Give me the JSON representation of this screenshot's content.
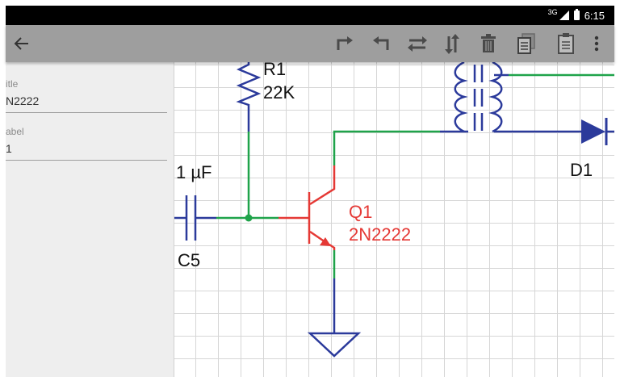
{
  "status_bar": {
    "network": "3G",
    "time": "6:15"
  },
  "toolbar": {
    "back_icon": "arrow-left-icon",
    "actions": [
      "rotate-right-icon",
      "rotate-left-icon",
      "flip-horizontal-icon",
      "flip-vertical-icon",
      "delete-icon",
      "copy-icon",
      "paste-icon",
      "overflow-menu-icon"
    ]
  },
  "properties": {
    "title_label": "itle",
    "title_value": "N2222",
    "label_label": "abel",
    "label_value": "1"
  },
  "schematic": {
    "resistor": {
      "name": "R1",
      "value": "22K"
    },
    "capacitor": {
      "value": "1 µF",
      "name": "C5"
    },
    "transistor": {
      "name": "Q1",
      "part": "2N2222"
    },
    "diode": {
      "name": "D1"
    },
    "colors": {
      "wire": "#1fa34a",
      "component": "#2b3a9b",
      "selected": "#e53935",
      "grid": "#d6d6d6"
    }
  }
}
